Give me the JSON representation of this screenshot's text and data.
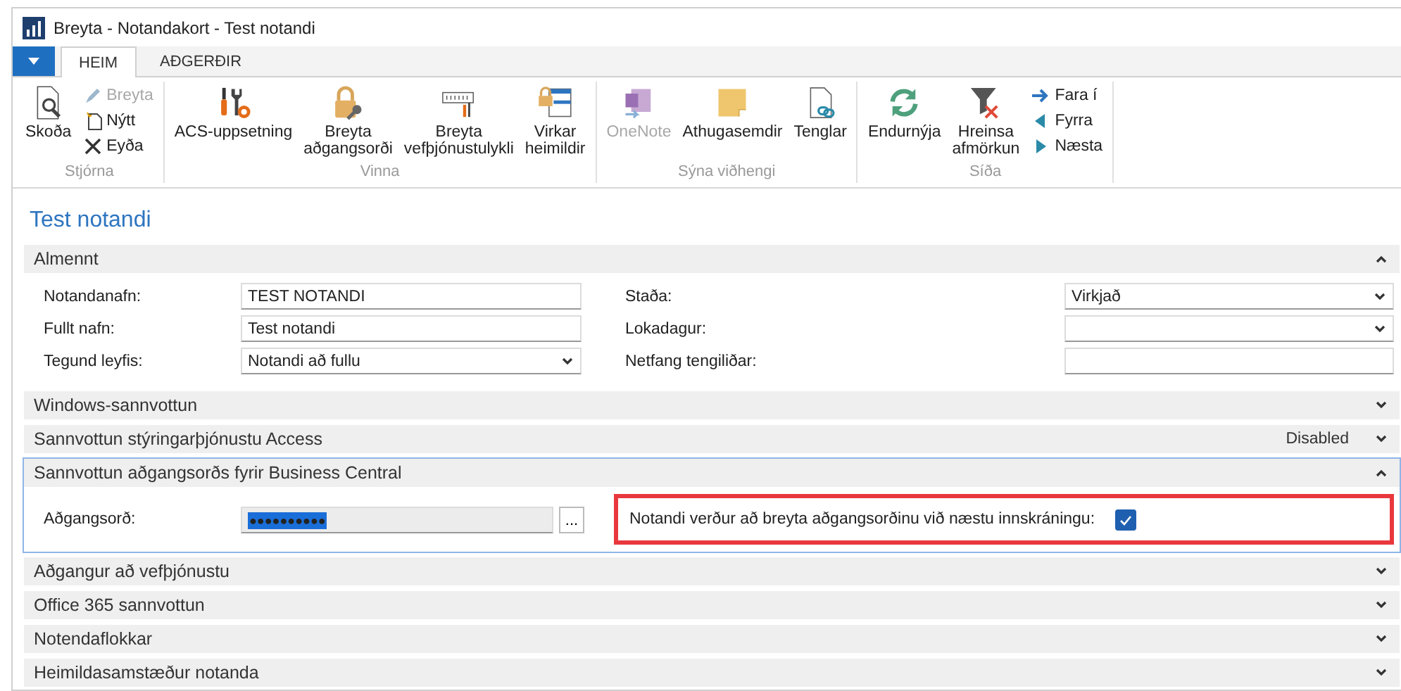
{
  "window": {
    "title": "Breyta - Notandakort - Test notandi"
  },
  "tabs": [
    {
      "label": "HEIM",
      "selected": true
    },
    {
      "label": "AÐGERÐIR",
      "selected": false
    }
  ],
  "ribbon": {
    "groups": [
      {
        "label": "Stjórna",
        "columns": [
          [
            {
              "label": "Skoða",
              "kind": "view",
              "disabled": false
            }
          ],
          [
            {
              "label": "Breyta",
              "kind": "edit",
              "disabled": true
            },
            {
              "label": "Nýtt",
              "kind": "new",
              "disabled": false
            },
            {
              "label": "Eyða",
              "kind": "delete",
              "disabled": false
            }
          ]
        ]
      },
      {
        "label": "Vinna",
        "columns": [
          [
            {
              "label": "ACS-uppsetning",
              "kind": "tools",
              "disabled": false
            }
          ],
          [
            {
              "label": "Breyta\naðgangsorði",
              "kind": "lock-key",
              "disabled": false
            }
          ],
          [
            {
              "label": "Breyta\nvefþjónustulykli",
              "kind": "keypad",
              "disabled": false
            }
          ],
          [
            {
              "label": "Virkar\nheimildir",
              "kind": "lock-window",
              "disabled": false
            }
          ]
        ]
      },
      {
        "label": "Sýna viðhengi",
        "columns": [
          [
            {
              "label": "OneNote",
              "kind": "onenote",
              "disabled": true
            }
          ],
          [
            {
              "label": "Athugasemdir",
              "kind": "note",
              "disabled": false
            }
          ],
          [
            {
              "label": "Tenglar",
              "kind": "link",
              "disabled": false
            }
          ]
        ]
      },
      {
        "label": "Síða",
        "columns": [
          [
            {
              "label": "Endurnýja",
              "kind": "refresh",
              "disabled": false
            }
          ],
          [
            {
              "label": "Hreinsa\nafmörkun",
              "kind": "filter-clear",
              "disabled": false
            }
          ],
          [
            {
              "label": "Fara í",
              "kind": "goto",
              "disabled": false
            },
            {
              "label": "Fyrra",
              "kind": "prev",
              "disabled": false
            },
            {
              "label": "Næsta",
              "kind": "next",
              "disabled": false
            }
          ]
        ]
      }
    ]
  },
  "page_title": "Test notandi",
  "sections": [
    {
      "title": "Almennt",
      "expanded": true,
      "kind": "grid",
      "fields": [
        {
          "label": "Notandanafn:",
          "value": "TEST NOTANDI",
          "kind": "text"
        },
        {
          "label": "Staða:",
          "value": "Virkjað",
          "kind": "dropdown"
        },
        {
          "label": "Fullt nafn:",
          "value": "Test notandi",
          "kind": "text"
        },
        {
          "label": "Lokadagur:",
          "kind": "dropdown"
        },
        {
          "label": "Tegund leyfis:",
          "value": "Notandi að fullu",
          "kind": "dropdown"
        },
        {
          "label": "Netfang tengiliðar:",
          "kind": "text"
        }
      ]
    },
    {
      "title": "Windows-sannvottun",
      "expanded": false
    },
    {
      "title": "Sannvottun stýringarþjónustu Access",
      "summary": "Disabled",
      "expanded": false
    },
    {
      "title": "Sannvottun aðgangsorðs fyrir Business Central",
      "expanded": true,
      "focused": true,
      "kind": "password",
      "fields": [
        {
          "label": "Aðgangsorð:",
          "value": "●●●●●●●●●●",
          "value_selected": true,
          "assist_button": "...",
          "kind": "password"
        },
        {
          "label": "Notandi verður að breyta aðgangsorðinu við næstu innskráningu:",
          "checked": true,
          "highlighted": true,
          "kind": "checkbox"
        }
      ]
    },
    {
      "title": "Aðgangur að vefþjónustu",
      "expanded": false
    },
    {
      "title": "Office 365 sannvottun",
      "expanded": false
    },
    {
      "title": "Notendaflokkar",
      "expanded": false
    },
    {
      "title": "Heimildasamstæður notanda",
      "expanded": false
    }
  ]
}
